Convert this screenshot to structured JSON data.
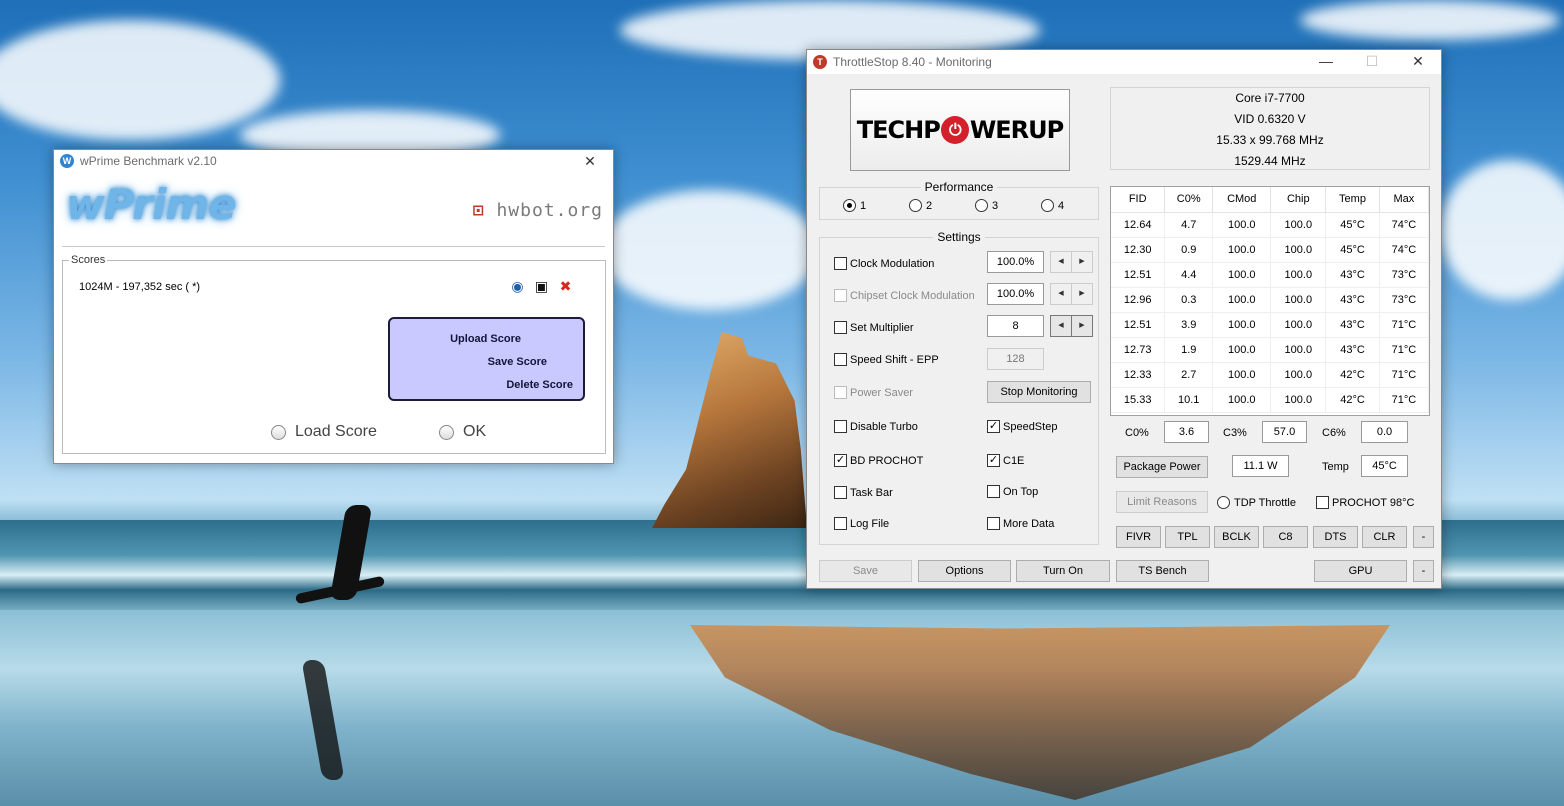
{
  "wprime": {
    "title": "wPrime Benchmark v2.10",
    "logo": "wPrime",
    "hwbot": "hwbot.org",
    "scores_label": "Scores",
    "score_entry": "1024M - 197,352 sec (  *)",
    "popup": {
      "upload": "Upload Score",
      "save": "Save Score",
      "delete": "Delete Score"
    },
    "load_score": "Load Score",
    "ok": "OK"
  },
  "ts": {
    "title": "ThrottleStop 8.40 - Monitoring",
    "logo_left": "TECHP",
    "logo_right": "WERUP",
    "cpu": {
      "name": "Core i7-7700",
      "vid": "VID  0.6320 V",
      "multiplier": "15.33 x 99.768 MHz",
      "freq": "1529.44 MHz"
    },
    "performance": {
      "title": "Performance",
      "options": [
        "1",
        "2",
        "3",
        "4"
      ],
      "selected": 0
    },
    "settings": {
      "title": "Settings",
      "clock_modulation": "Clock Modulation",
      "clock_modulation_value": "100.0%",
      "chipset_clock_modulation": "Chipset Clock Modulation",
      "chipset_clock_modulation_value": "100.0%",
      "set_multiplier": "Set Multiplier",
      "set_multiplier_value": "8",
      "speed_shift": "Speed Shift - EPP",
      "speed_shift_value": "128",
      "power_saver": "Power Saver",
      "stop_monitoring": "Stop Monitoring",
      "disable_turbo": "Disable Turbo",
      "speedstep": "SpeedStep",
      "bd_prochot": "BD PROCHOT",
      "c1e": "C1E",
      "task_bar": "Task Bar",
      "on_top": "On Top",
      "log_file": "Log File",
      "more_data": "More Data"
    },
    "table": {
      "headers": [
        "FID",
        "C0%",
        "CMod",
        "Chip",
        "Temp",
        "Max"
      ],
      "rows": [
        [
          "12.64",
          "4.7",
          "100.0",
          "100.0",
          "45°C",
          "74°C"
        ],
        [
          "12.30",
          "0.9",
          "100.0",
          "100.0",
          "45°C",
          "74°C"
        ],
        [
          "12.51",
          "4.4",
          "100.0",
          "100.0",
          "43°C",
          "73°C"
        ],
        [
          "12.96",
          "0.3",
          "100.0",
          "100.0",
          "43°C",
          "73°C"
        ],
        [
          "12.51",
          "3.9",
          "100.0",
          "100.0",
          "43°C",
          "71°C"
        ],
        [
          "12.73",
          "1.9",
          "100.0",
          "100.0",
          "43°C",
          "71°C"
        ],
        [
          "12.33",
          "2.7",
          "100.0",
          "100.0",
          "42°C",
          "71°C"
        ],
        [
          "15.33",
          "10.1",
          "100.0",
          "100.0",
          "42°C",
          "71°C"
        ]
      ]
    },
    "stats": {
      "c0_label": "C0%",
      "c0_value": "3.6",
      "c3_label": "C3%",
      "c3_value": "57.0",
      "c6_label": "C6%",
      "c6_value": "0.0",
      "package_power": "Package Power",
      "package_power_value": "11.1 W",
      "temp_label": "Temp",
      "temp_value": "45°C",
      "limit_reasons": "Limit Reasons",
      "tdp_throttle": "TDP Throttle",
      "prochot": "PROCHOT 98°C"
    },
    "tool_buttons": [
      "FIVR",
      "TPL",
      "BCLK",
      "C8",
      "DTS",
      "CLR",
      "-"
    ],
    "bottom": {
      "save": "Save",
      "options": "Options",
      "turn_on": "Turn On",
      "ts_bench": "TS Bench",
      "gpu": "GPU",
      "dash": "-"
    }
  }
}
